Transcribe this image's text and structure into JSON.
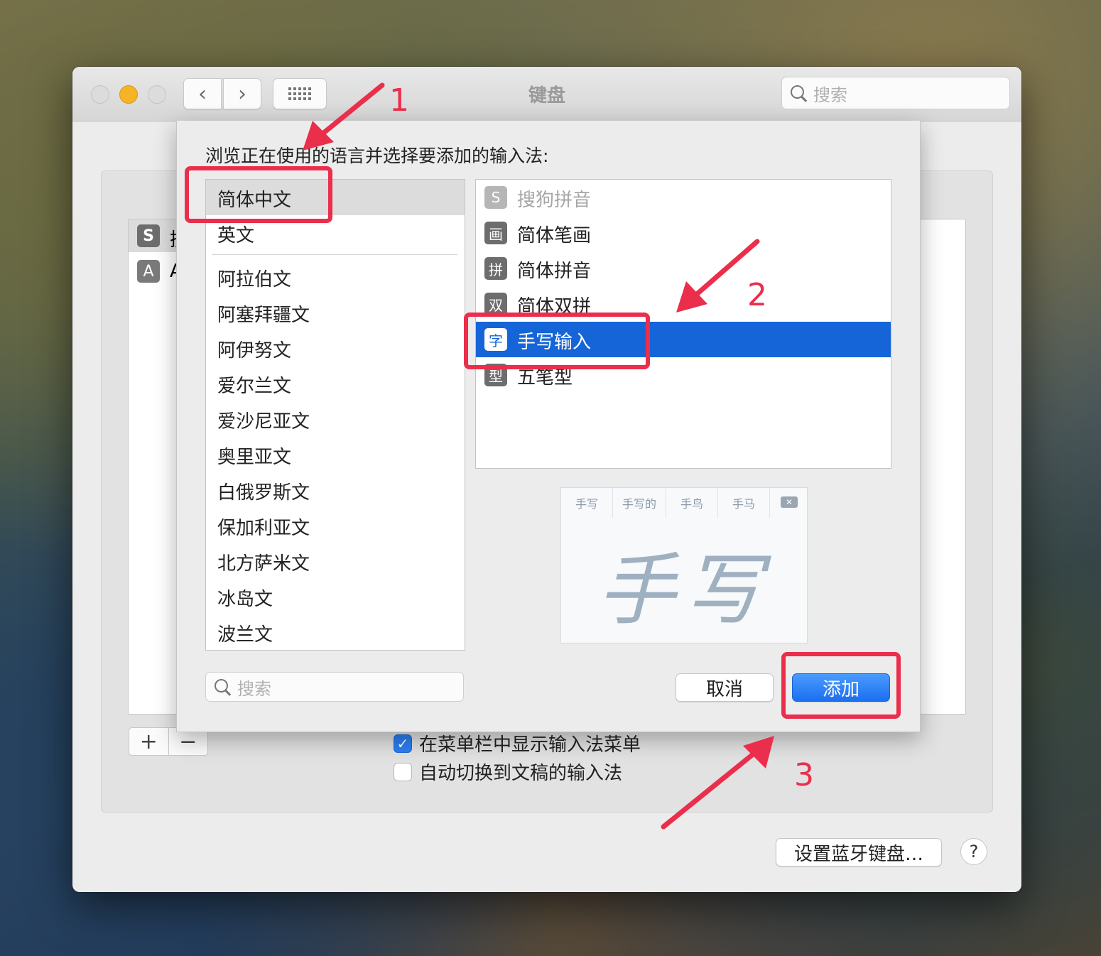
{
  "window": {
    "title": "键盘",
    "search_placeholder": "搜索",
    "nav": {
      "back": "‹",
      "forward": "›"
    },
    "grid_icon": "grid-icon"
  },
  "background_panel": {
    "input_sources": [
      {
        "icon": "sogou-icon",
        "icon_text": "S",
        "label": "搜"
      },
      {
        "icon": "abc-icon",
        "icon_text": "A",
        "label": "A"
      }
    ],
    "add": "+",
    "remove": "−",
    "show_menu_checkbox": {
      "label": "在菜单栏中显示输入法菜单",
      "checked": true
    },
    "auto_switch_checkbox": {
      "label": "自动切换到文稿的输入法",
      "checked": false
    },
    "bluetooth_button": "设置蓝牙键盘…",
    "help": "?"
  },
  "sheet": {
    "title": "浏览正在使用的语言并选择要添加的输入法:",
    "languages_top": [
      "简体中文",
      "英文"
    ],
    "languages": [
      "阿拉伯文",
      "阿塞拜疆文",
      "阿伊努文",
      "爱尔兰文",
      "爱沙尼亚文",
      "奥里亚文",
      "白俄罗斯文",
      "保加利亚文",
      "北方萨米文",
      "冰岛文",
      "波兰文"
    ],
    "selected_language": "简体中文",
    "input_methods": [
      {
        "icon_text": "S",
        "label": "搜狗拼音",
        "state": "disabled"
      },
      {
        "icon_text": "画",
        "label": "简体笔画",
        "state": "normal"
      },
      {
        "icon_text": "拼",
        "label": "简体拼音",
        "state": "normal"
      },
      {
        "icon_text": "双",
        "label": "简体双拼",
        "state": "normal"
      },
      {
        "icon_text": "字",
        "label": "手写输入",
        "state": "selected"
      },
      {
        "icon_text": "型",
        "label": "五笔型",
        "state": "normal"
      }
    ],
    "preview": {
      "candidates": [
        "手写",
        "手写的",
        "手鸟",
        "手马"
      ],
      "handwriting": "手写"
    },
    "search_placeholder": "搜索",
    "cancel": "取消",
    "add": "添加"
  },
  "annotations": {
    "step1": "1",
    "step2": "2",
    "step3": "3",
    "color": "#ea2e4b"
  }
}
